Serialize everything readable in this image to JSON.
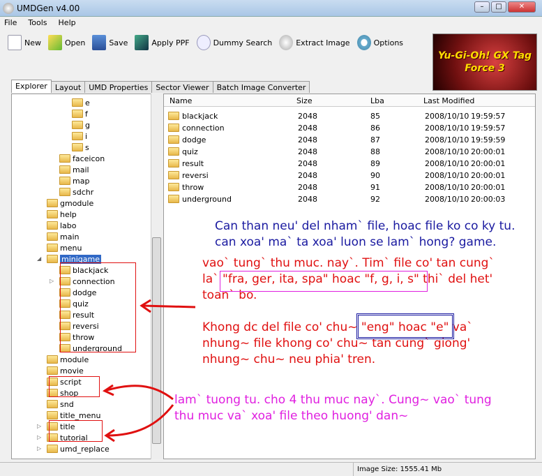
{
  "window": {
    "title": "UMDGen v4.00"
  },
  "menu": [
    "File",
    "Tools",
    "Help"
  ],
  "toolbar": [
    {
      "label": "New",
      "icon": "new-file-icon"
    },
    {
      "label": "Open",
      "icon": "open-folder-icon"
    },
    {
      "label": "Save",
      "icon": "save-disk-icon"
    },
    {
      "label": "Apply PPF",
      "icon": "cube-icon"
    },
    {
      "label": "Dummy Search",
      "icon": "search-icon"
    },
    {
      "label": "Extract Image",
      "icon": "disc-icon"
    },
    {
      "label": "Options",
      "icon": "gear-icon"
    }
  ],
  "banner": {
    "text": "Yu-Gi-Oh! GX Tag Force 3"
  },
  "tabs": [
    "Explorer",
    "Layout",
    "UMD Properties",
    "Sector Viewer",
    "Batch Image Converter"
  ],
  "tree": [
    {
      "label": "e",
      "level": 3
    },
    {
      "label": "f",
      "level": 3
    },
    {
      "label": "g",
      "level": 3
    },
    {
      "label": "i",
      "level": 3
    },
    {
      "label": "s",
      "level": 3
    },
    {
      "label": "faceicon",
      "level": 2
    },
    {
      "label": "mail",
      "level": 2
    },
    {
      "label": "map",
      "level": 2
    },
    {
      "label": "sdchr",
      "level": 2
    },
    {
      "label": "gmodule",
      "level": 1
    },
    {
      "label": "help",
      "level": 1
    },
    {
      "label": "labo",
      "level": 1
    },
    {
      "label": "main",
      "level": 1
    },
    {
      "label": "menu",
      "level": 1
    },
    {
      "label": "minigame",
      "level": 1,
      "selected": true,
      "expanded": true
    },
    {
      "label": "blackjack",
      "level": 2
    },
    {
      "label": "connection",
      "level": 2,
      "expandable": true
    },
    {
      "label": "dodge",
      "level": 2
    },
    {
      "label": "quiz",
      "level": 2
    },
    {
      "label": "result",
      "level": 2
    },
    {
      "label": "reversi",
      "level": 2
    },
    {
      "label": "throw",
      "level": 2
    },
    {
      "label": "underground",
      "level": 2
    },
    {
      "label": "module",
      "level": 1
    },
    {
      "label": "movie",
      "level": 1
    },
    {
      "label": "script",
      "level": 1
    },
    {
      "label": "shop",
      "level": 1
    },
    {
      "label": "snd",
      "level": 1
    },
    {
      "label": "title_menu",
      "level": 1
    },
    {
      "label": "title",
      "level": 1,
      "expandable": true
    },
    {
      "label": "tutorial",
      "level": 1,
      "expandable": true
    },
    {
      "label": "umd_replace",
      "level": 1,
      "expandable": true
    }
  ],
  "list": {
    "columns": [
      "Name",
      "Size",
      "Lba",
      "Last Modified"
    ],
    "rows": [
      [
        "blackjack",
        "2048",
        "85",
        "2008/10/10",
        "19:59:57"
      ],
      [
        "connection",
        "2048",
        "86",
        "2008/10/10",
        "19:59:57"
      ],
      [
        "dodge",
        "2048",
        "87",
        "2008/10/10",
        "19:59:59"
      ],
      [
        "quiz",
        "2048",
        "88",
        "2008/10/10",
        "20:00:01"
      ],
      [
        "result",
        "2048",
        "89",
        "2008/10/10",
        "20:00:01"
      ],
      [
        "reversi",
        "2048",
        "90",
        "2008/10/10",
        "20:00:01"
      ],
      [
        "throw",
        "2048",
        "91",
        "2008/10/10",
        "20:00:01"
      ],
      [
        "underground",
        "2048",
        "92",
        "2008/10/10",
        "20:00:03"
      ]
    ]
  },
  "annotations": {
    "blue": [
      "Can than neu' del nham` file, hoac file ko co ky tu.",
      "can xoa' ma` ta xoa' luon se lam` hong? game."
    ],
    "red1": [
      "vao` tung` thu muc. nay`. Tim` file co' tan cung`",
      "la` ",
      "\"fra, ger, ita, spa\" hoac \"f, g, i, s\"",
      " thi` del het'",
      "toan` bo."
    ],
    "red2": [
      "Khong dc del file co' chu~ ",
      "\"eng\" hoac \"e\"",
      " va`",
      "nhung~ file khong co' chu~ tan cung` giong'",
      "nhung~ chu~ neu phia' tren."
    ],
    "magenta": [
      "lam` tuong tu. cho 4 thu muc nay`. Cung~ vao` tung",
      "thu muc va` xoa' file theo huong' dan~"
    ],
    "colors": {
      "blue": "#1a1aa0",
      "red": "#e01010",
      "magenta": "#e020e0"
    }
  },
  "status": {
    "image_size": "Image Size: 1555.41 Mb"
  }
}
